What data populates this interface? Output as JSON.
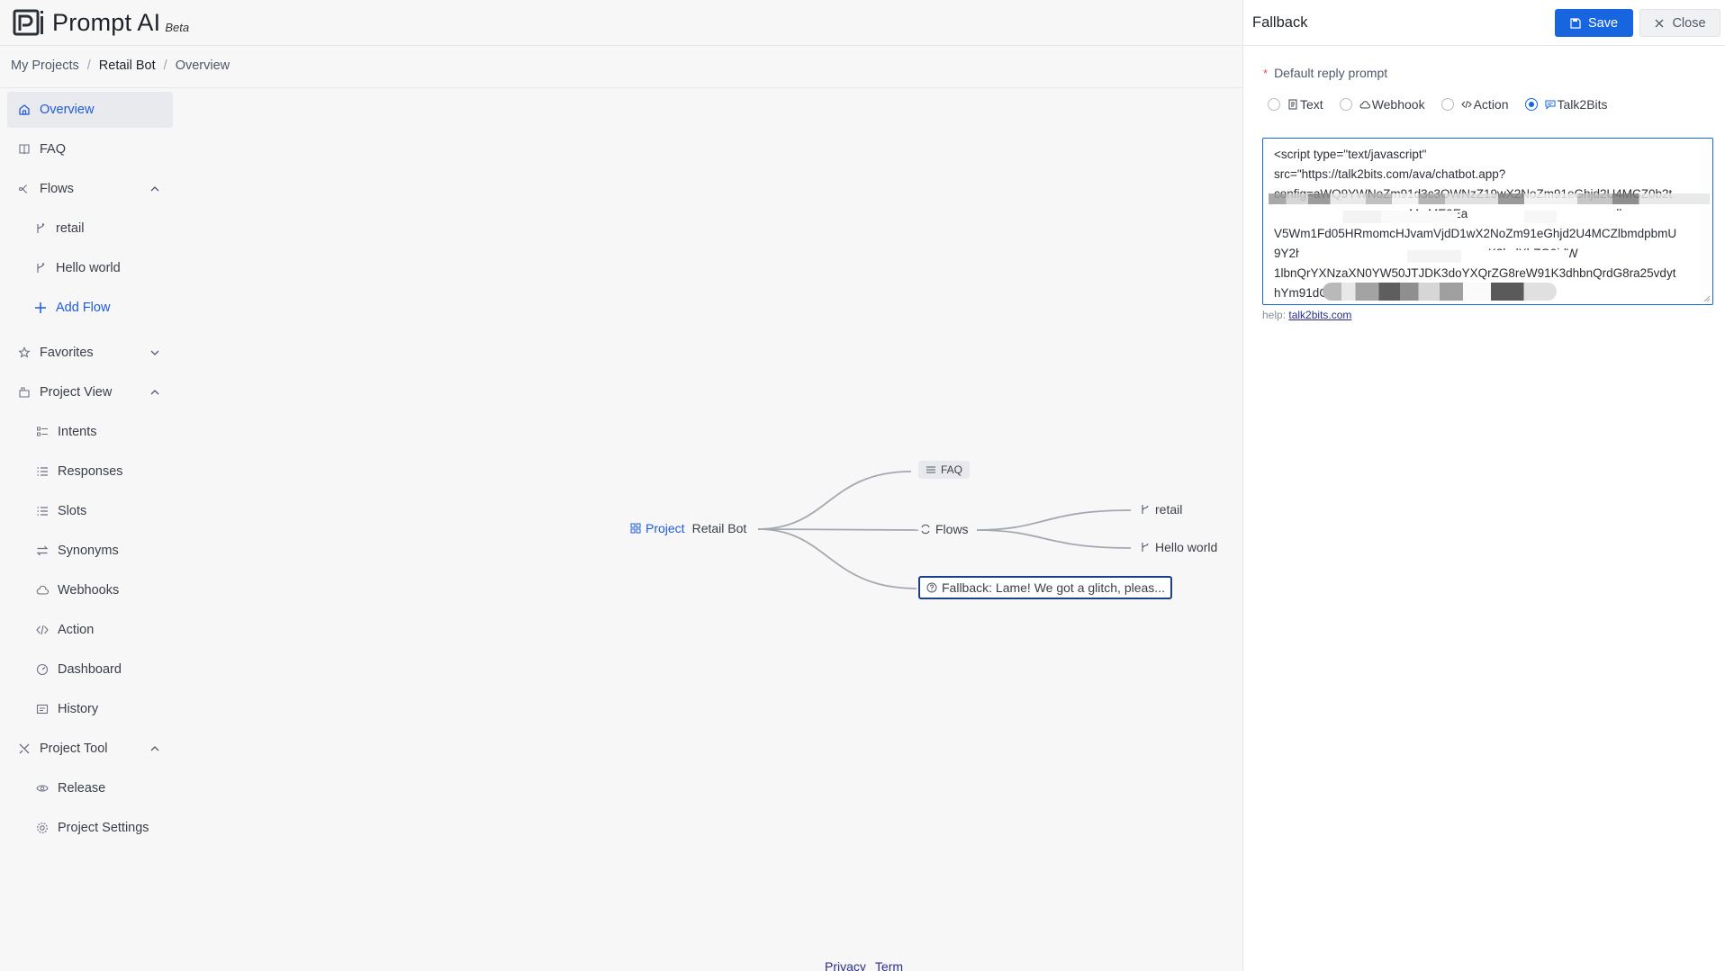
{
  "brand": {
    "name": "Prompt AI",
    "badge": "Beta"
  },
  "breadcrumb": [
    "My Projects",
    "Retail Bot",
    "Overview"
  ],
  "sidebar": {
    "overview": "Overview",
    "faq": "FAQ",
    "flows": "Flows",
    "flow_items": [
      "retail",
      "Hello world"
    ],
    "add_flow": "Add Flow",
    "favorites": "Favorites",
    "project_view": "Project View",
    "project_view_items": [
      "Intents",
      "Responses",
      "Slots",
      "Synonyms",
      "Webhooks",
      "Action",
      "Dashboard",
      "History"
    ],
    "project_tool": "Project Tool",
    "project_tool_items": [
      "Release",
      "Project Settings"
    ]
  },
  "mindmap": {
    "root_prefix": "Project",
    "root_name": "Retail Bot",
    "faq": "FAQ",
    "flows": "Flows",
    "flow_children": [
      "retail",
      "Hello world"
    ],
    "fallback": "Fallback: Lame! We got a glitch, pleas..."
  },
  "footer": {
    "privacy": "Privacy",
    "term": "Term"
  },
  "drawer": {
    "title": "Fallback",
    "save_label": "Save",
    "close_label": "Close",
    "field_label": "Default reply prompt",
    "options": [
      "Text",
      "Webhook",
      "Action",
      "Talk2Bits"
    ],
    "selected_option": "Talk2Bits",
    "code_lines": [
      "<script type=\"text/javascript\"",
      "src=\"https://talk2bits.com/ava/chatbot.app?",
      "config=aWQ9YWNoZm91d3c3OWNzZ19wX2NoZm91eGhjd2U4MCZ0b2t",
      "                                        MwME9Ea                                            lk",
      "V5Wm1Fd05HRmomcHJvamVjdD1wX2NoZm91eGhjd2U4MCZlbmdpbmU",
      "9Y2h                                                      .K3lvdXlrZG9jdW",
      "1lbnQrYXNzaXN0YW50JTJDK3doYXQrZG8reW91K3dhbnQrdG8ra25vdyt",
      "hYm91dC                                                   >"
    ],
    "help_prefix": "help:",
    "help_link": "talk2bits.com"
  },
  "colors": {
    "accent": "#1766e0",
    "link": "#1f5bd8",
    "selected_node_border": "#1b3f8b"
  }
}
